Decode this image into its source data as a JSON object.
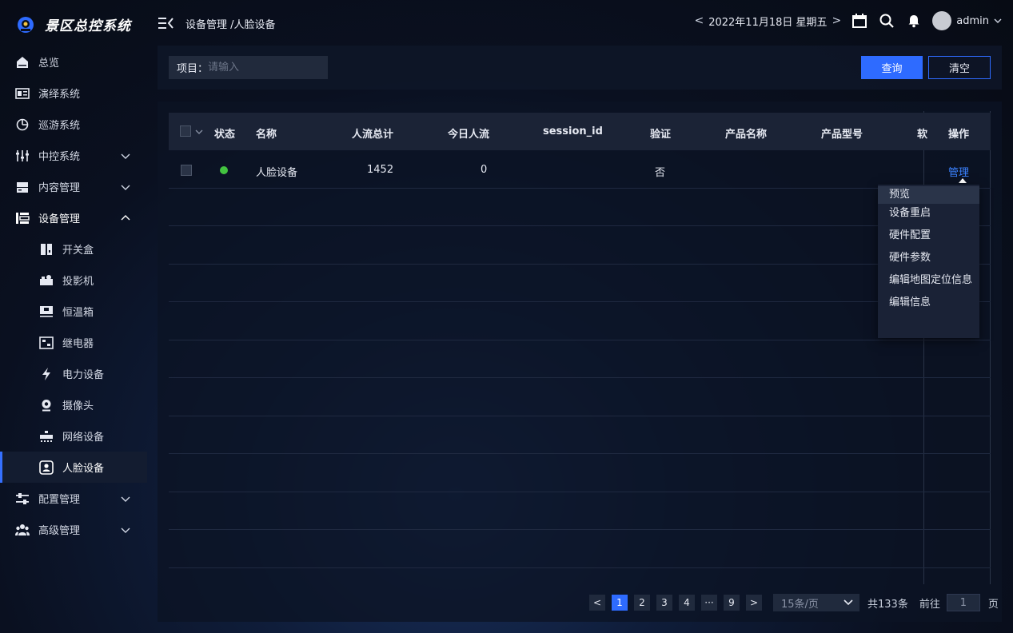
{
  "app": {
    "title": "景区总控系统"
  },
  "header": {
    "breadcrumb": "设备管理 /人脸设备",
    "date": "2022年11月18日  星期五",
    "prev": "<",
    "next": ">",
    "username": "admin"
  },
  "sidebar": {
    "items": [
      {
        "label": "总览"
      },
      {
        "label": "演绎系统"
      },
      {
        "label": "巡游系统"
      },
      {
        "label": "中控系统"
      },
      {
        "label": "内容管理"
      },
      {
        "label": "设备管理"
      },
      {
        "label": "开关盒"
      },
      {
        "label": "投影机"
      },
      {
        "label": "恒温箱"
      },
      {
        "label": "继电器"
      },
      {
        "label": "电力设备"
      },
      {
        "label": "摄像头"
      },
      {
        "label": "网络设备"
      },
      {
        "label": "人脸设备"
      },
      {
        "label": "配置管理"
      },
      {
        "label": "高级管理"
      }
    ]
  },
  "search": {
    "label": "项目：",
    "placeholder": "请输入",
    "query_label": "查询",
    "clear_label": "清空"
  },
  "table": {
    "columns": [
      "状态",
      "名称",
      "人流总计",
      "今日人流",
      "session_id",
      "验证",
      "产品名称",
      "产品型号",
      "软",
      "操作"
    ],
    "rows": [
      {
        "status": "online",
        "name": "人脸设备",
        "total": "1452",
        "today": "0",
        "session_id": "",
        "verified": "否",
        "product_name": "",
        "product_model": "",
        "action": "管理"
      }
    ]
  },
  "dropdown": {
    "items": [
      "预览",
      "设备重启",
      "硬件配置",
      "硬件参数",
      "编辑地图定位信息",
      "编辑信息"
    ]
  },
  "pagination": {
    "prev": "<",
    "next": ">",
    "pages": [
      "1",
      "2",
      "3",
      "4",
      "···",
      "9"
    ],
    "current": "1",
    "page_size": "15条/页",
    "total": "共133条",
    "goto_label": "前往",
    "goto_value": "1",
    "page_suffix": "页"
  },
  "colors": {
    "accent": "#2e6bff",
    "online": "#43c440",
    "link": "#3b82ff"
  }
}
